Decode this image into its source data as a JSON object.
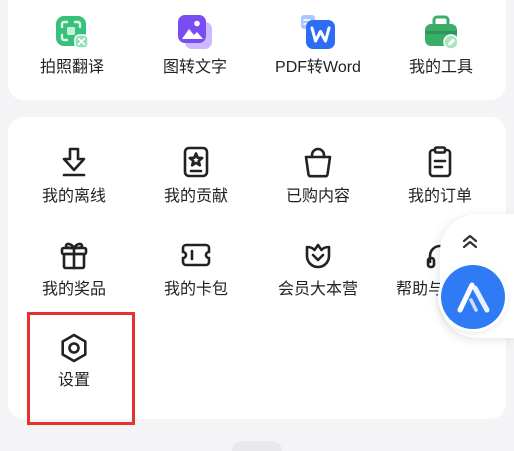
{
  "colors": {
    "background": "#f4f4f6",
    "card": "#ffffff",
    "text": "#222222",
    "highlight": "#e5322d",
    "brand": "#2f7bf6"
  },
  "tools": {
    "items": [
      {
        "label": "拍照翻译",
        "icon": "photo-translate-icon",
        "color": "#36c27b"
      },
      {
        "label": "图转文字",
        "icon": "image-to-text-icon",
        "color": "#7b4cf2"
      },
      {
        "label": "PDF转Word",
        "icon": "pdf-to-word-icon",
        "color": "#2d6cf5"
      },
      {
        "label": "我的工具",
        "icon": "toolbox-icon",
        "color": "#3aae69"
      }
    ]
  },
  "menu": {
    "items": [
      {
        "label": "我的离线",
        "icon": "download-icon"
      },
      {
        "label": "我的贡献",
        "icon": "star-badge-icon"
      },
      {
        "label": "已购内容",
        "icon": "shopping-bag-icon"
      },
      {
        "label": "我的订单",
        "icon": "clipboard-icon"
      },
      {
        "label": "我的奖品",
        "icon": "gift-icon"
      },
      {
        "label": "我的卡包",
        "icon": "ticket-icon"
      },
      {
        "label": "会员大本营",
        "icon": "member-shield-icon"
      },
      {
        "label": "帮助与",
        "icon": "headphones-icon"
      },
      {
        "label": "设置",
        "icon": "settings-icon"
      }
    ]
  },
  "floating": {
    "scroll_top_icon": "double-chevron-up-icon",
    "assistant_icon": "assistant-logo-icon"
  }
}
